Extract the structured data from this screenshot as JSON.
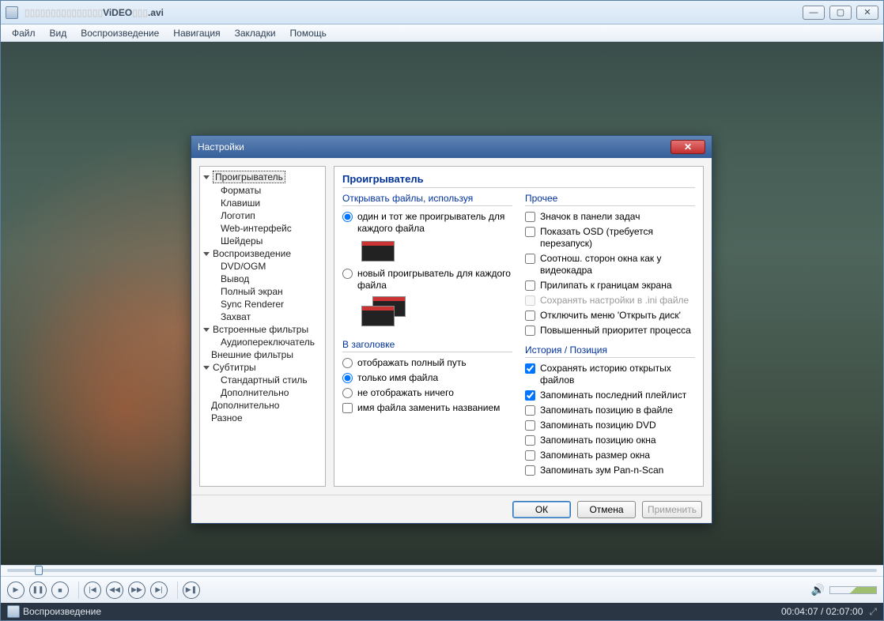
{
  "window": {
    "title_suffix": ".avi",
    "title_mid": "ViDEO"
  },
  "menu": [
    "Файл",
    "Вид",
    "Воспроизведение",
    "Навигация",
    "Закладки",
    "Помощь"
  ],
  "status": {
    "state": "Воспроизведение",
    "time": "00:04:07 / 02:07:00"
  },
  "dialog": {
    "title": "Настройки",
    "heading": "Проигрыватель",
    "tree": {
      "player": "Проигрыватель",
      "formats": "Форматы",
      "keys": "Клавиши",
      "logo": "Логотип",
      "web": "Web-интерфейс",
      "shaders": "Шейдеры",
      "playback": "Воспроизведение",
      "dvd": "DVD/OGM",
      "output": "Вывод",
      "fullscreen": "Полный экран",
      "sync": "Sync Renderer",
      "capture": "Захват",
      "intfilters": "Встроенные фильтры",
      "audiosw": "Аудиопереключатель",
      "extfilters": "Внешние фильтры",
      "subtitles": "Субтитры",
      "stdstyle": "Стандартный стиль",
      "extra_sub": "Дополнительно",
      "extra": "Дополнительно",
      "misc": "Разное"
    },
    "left": {
      "group_open": "Открывать файлы, используя",
      "radio_same": "один и тот же проигрыватель для каждого файла",
      "radio_new": "новый проигрыватель для каждого файла",
      "group_title": "В заголовке",
      "radio_full": "отображать полный путь",
      "radio_name": "только имя файла",
      "radio_none": "не отображать ничего",
      "chk_replace": "имя файла заменить названием"
    },
    "right": {
      "group_other": "Прочее",
      "chk_tray": "Значок в панели задач",
      "chk_osd": "Показать OSD (требуется перезапуск)",
      "chk_aspect": "Соотнош. сторон окна как у видеокадра",
      "chk_snap": "Прилипать к границам экрана",
      "chk_ini": "Сохранять настройки в .ini файле",
      "chk_nodisc": "Отключить меню 'Открыть диск'",
      "chk_prio": "Повышенный приоритет процесса",
      "group_hist": "История / Позиция",
      "chk_hist": "Сохранять историю открытых файлов",
      "chk_playlist": "Запоминать последний плейлист",
      "chk_filepos": "Запоминать позицию в файле",
      "chk_dvdpos": "Запоминать позицию DVD",
      "chk_winpos": "Запоминать позицию окна",
      "chk_winsize": "Запоминать размер окна",
      "chk_panzoom": "Запоминать зум Pan-n-Scan"
    },
    "buttons": {
      "ok": "ОК",
      "cancel": "Отмена",
      "apply": "Применить"
    }
  }
}
